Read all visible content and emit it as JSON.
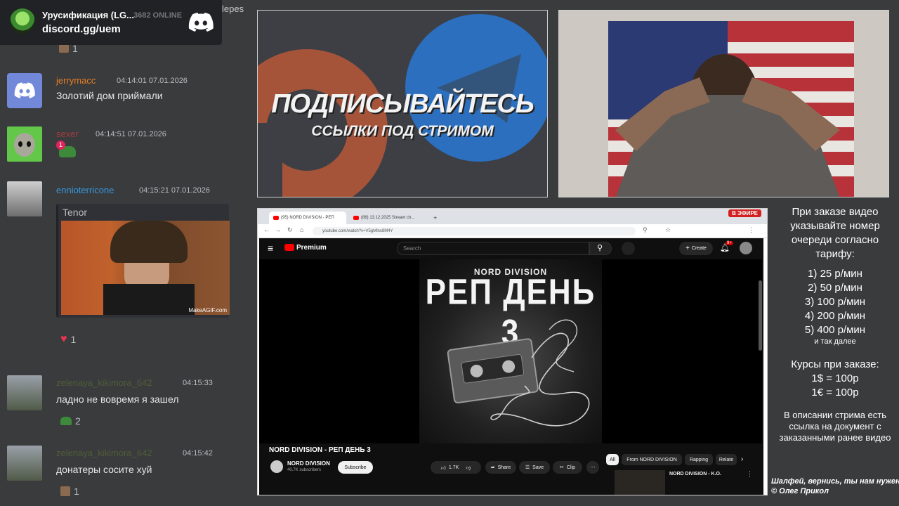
{
  "discord_widget": {
    "server_name": "Урусификация (LG...",
    "online_count": "3682 ONLINE",
    "invite_link": "discord.gg/uem"
  },
  "cut_text": "lepes",
  "chat": {
    "top_reaction_count": "1",
    "messages": [
      {
        "username": "jerrymacc",
        "username_color": "#e67e22",
        "timestamp": "04:14:01 07.01.2026",
        "text": "Золотий дом приймали",
        "avatar": "discord-default-avatar"
      },
      {
        "username": "sexer",
        "username_color": "#a33c3c",
        "timestamp": "04:14:51 07.01.2026",
        "text": "",
        "avatar": "alien-avatar",
        "emoji_badge": "1"
      },
      {
        "username": "ennioterricone",
        "username_color": "#3498db",
        "timestamp": "04:15:21 07.01.2026",
        "text": "",
        "avatar": "man-photo-avatar",
        "embed_label": "Tenor",
        "gif_watermark": "MakeAGIF.com",
        "reaction_count": "1"
      },
      {
        "username": "zelenaya_kikimora_642",
        "username_color": "#4e5d38",
        "timestamp": "04:15:33",
        "text": "ладно не вовремя я зашел",
        "avatar": "soldier-avatar",
        "reaction_count": "2"
      },
      {
        "username": "zelenaya_kikimora_642",
        "username_color": "#4e5d38",
        "timestamp": "04:15:42",
        "text": "донатеры сосите хуй",
        "avatar": "soldier-avatar",
        "reaction_count": "1"
      }
    ]
  },
  "promo": {
    "title": "ПОДПИСЫВАЙТЕСЬ",
    "subtitle": "ССЫЛКИ ПОД СТРИМОМ"
  },
  "browser": {
    "tabs": [
      "(95) NORD DIVISION - РЕП",
      "(88) 13.12.2025 Stream ch..."
    ],
    "live_badge": "В ЭФИРЕ",
    "url": "youtube.com/watch?v=V5gMlnc8M4Y"
  },
  "youtube": {
    "logo_text": "Premium",
    "search_placeholder": "Search",
    "create_label": "Create",
    "notification_count": "9+",
    "cover_artist": "NORD DIVISION",
    "cover_album": "РЕП ДЕНЬ 3",
    "video_title": "NORD DIVISION - РЕП ДЕНЬ 3",
    "channel_name": "NORD DIVISION",
    "channel_subs": "40.7K subscribers",
    "subscribe_label": "Subscribe",
    "like_count": "1.7K",
    "share_label": "Share",
    "save_label": "Save",
    "clip_label": "Clip",
    "chips": [
      "All",
      "From NORD DIVISION",
      "Rapping",
      "Relate"
    ],
    "rec_title": "NORD DIVISION - K.O."
  },
  "info": {
    "intro": "При заказе видео указывайте номер очереди согласно тарифу:",
    "tariffs": [
      "1) 25 р/мин",
      "2) 50 р/мин",
      "3) 100 р/мин",
      "4) 200 р/мин",
      "5) 400 р/мин"
    ],
    "tariffs_more": "и так далее",
    "rates_title": "Курсы при заказе:",
    "rates": [
      "1$ = 100р",
      "1€ = 100р"
    ],
    "description_note": "В описании стрима есть ссылка на документ с заказанными ранее видео"
  },
  "bottom_note": [
    "Шалфей, вернись, ты нам нужен.",
    "© Олег Прикол"
  ],
  "colors": {
    "discord_bg": "#202225",
    "page_bg": "#3a3b3d",
    "youtube_red": "#ff0000",
    "heart": "#e8344e"
  }
}
